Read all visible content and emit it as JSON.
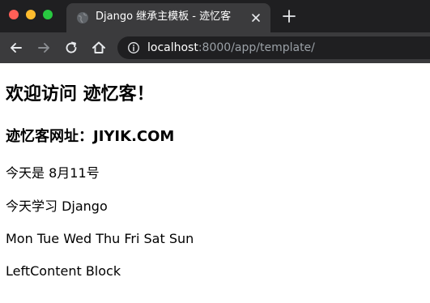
{
  "browser": {
    "tab_title": "Django 继承主模板 - 迹忆客",
    "url_host": "localhost",
    "url_rest": ":8000/app/template/"
  },
  "icons": {
    "back": "arrow-left-icon",
    "forward": "arrow-right-icon",
    "reload": "reload-icon",
    "home": "home-icon",
    "info": "info-icon",
    "close": "close-icon",
    "new_tab": "plus-icon",
    "favicon": "globe-icon"
  },
  "colors": {
    "tab_bar": "#1f1f21",
    "toolbar": "#3b3b3d",
    "traffic_red": "#ff5f57",
    "traffic_yellow": "#febc2e",
    "traffic_green": "#28c840"
  },
  "page": {
    "heading": "欢迎访问 迹忆客！",
    "subheading": "迹忆客网址：JIYIK.COM",
    "date_line": "今天是 8月11号",
    "study_line": "今天学习 Django",
    "days_line": "Mon Tue Wed Thu Fri Sat Sun",
    "block_line": "LeftContent Block"
  }
}
